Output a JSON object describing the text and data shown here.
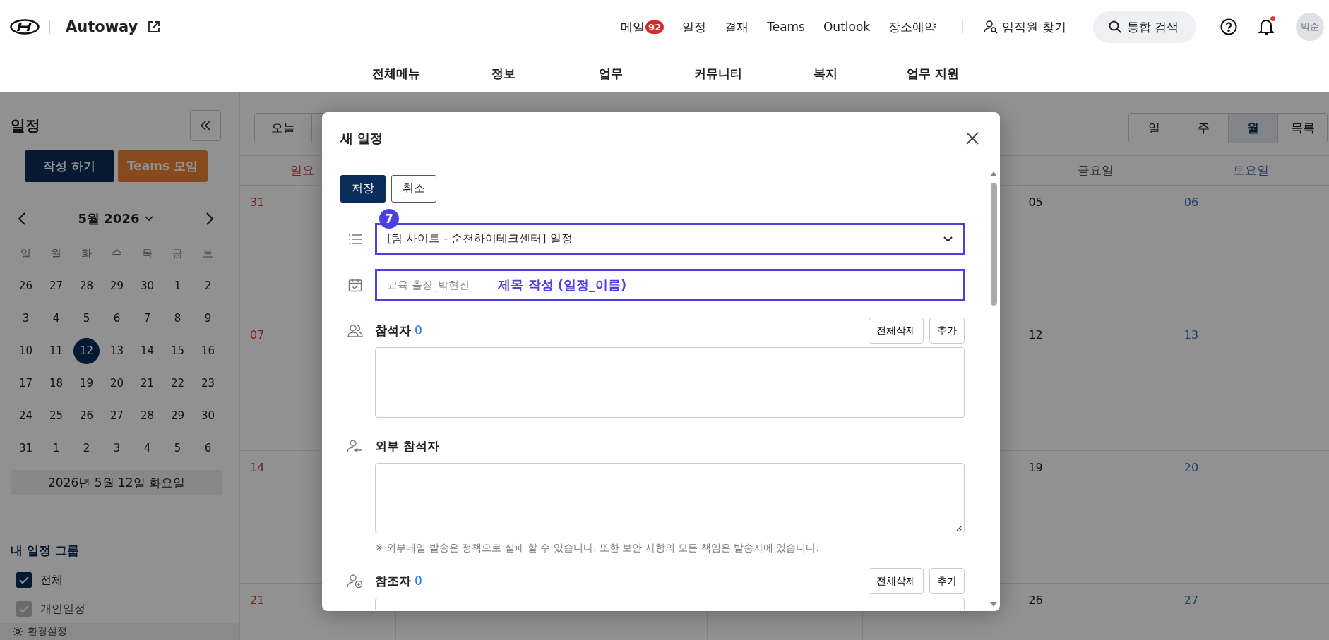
{
  "header": {
    "site_name": "Autoway",
    "nav_links": [
      {
        "label": "메일",
        "badge": "92"
      },
      {
        "label": "일정"
      },
      {
        "label": "결재"
      },
      {
        "label": "Teams"
      },
      {
        "label": "Outlook"
      },
      {
        "label": "장소예약"
      }
    ],
    "people_search": "임직원 찾기",
    "search_button": "통합 검색",
    "notifications": {
      "unread": true
    },
    "avatar": "박순"
  },
  "main_menu": [
    "전체메뉴",
    "정보",
    "업무",
    "커뮤니티",
    "복지",
    "업무 지원"
  ],
  "sidebar": {
    "title": "일정",
    "create_button": "작성 하기",
    "teams_button": "Teams 모임",
    "mini_calendar": {
      "month": "5월 2026",
      "weekdays": [
        "일",
        "월",
        "화",
        "수",
        "목",
        "금",
        "토"
      ],
      "weeks": [
        [
          {
            "label": "26",
            "selected": false
          },
          {
            "label": "27",
            "selected": false
          },
          {
            "label": "28",
            "selected": false
          },
          {
            "label": "29",
            "selected": false
          },
          {
            "label": "30",
            "selected": false
          },
          {
            "label": "1",
            "selected": false
          },
          {
            "label": "2",
            "selected": false
          }
        ],
        [
          {
            "label": "3",
            "selected": false
          },
          {
            "label": "4",
            "selected": false
          },
          {
            "label": "5",
            "selected": false
          },
          {
            "label": "6",
            "selected": false
          },
          {
            "label": "7",
            "selected": false
          },
          {
            "label": "8",
            "selected": false
          },
          {
            "label": "9",
            "selected": false
          }
        ],
        [
          {
            "label": "10",
            "selected": false
          },
          {
            "label": "11",
            "selected": false
          },
          {
            "label": "12",
            "selected": true
          },
          {
            "label": "13",
            "selected": false
          },
          {
            "label": "14",
            "selected": false
          },
          {
            "label": "15",
            "selected": false
          },
          {
            "label": "16",
            "selected": false
          }
        ],
        [
          {
            "label": "17",
            "selected": false
          },
          {
            "label": "18",
            "selected": false
          },
          {
            "label": "19",
            "selected": false
          },
          {
            "label": "20",
            "selected": false
          },
          {
            "label": "21",
            "selected": false
          },
          {
            "label": "22",
            "selected": false
          },
          {
            "label": "23",
            "selected": false
          }
        ],
        [
          {
            "label": "24",
            "selected": false
          },
          {
            "label": "25",
            "selected": false
          },
          {
            "label": "26",
            "selected": false
          },
          {
            "label": "27",
            "selected": false
          },
          {
            "label": "28",
            "selected": false
          },
          {
            "label": "29",
            "selected": false
          },
          {
            "label": "30",
            "selected": false
          }
        ],
        [
          {
            "label": "31",
            "selected": false
          },
          {
            "label": "1",
            "selected": false
          },
          {
            "label": "2",
            "selected": false
          },
          {
            "label": "3",
            "selected": false
          },
          {
            "label": "4",
            "selected": false
          },
          {
            "label": "5",
            "selected": false
          },
          {
            "label": "6",
            "selected": false
          }
        ]
      ]
    },
    "selected_date": "2026년 5월 12일 화요일",
    "group_title": "내 일정 그룹",
    "groups": [
      {
        "label": "전체",
        "checked": true,
        "disabled": false
      },
      {
        "label": "개인일정",
        "checked": true,
        "disabled": true
      }
    ],
    "settings": "환경설정"
  },
  "calendar": {
    "today_button": "오늘",
    "views": [
      {
        "label": "일",
        "selected": false
      },
      {
        "label": "주",
        "selected": false
      },
      {
        "label": "월",
        "selected": true
      },
      {
        "label": "목록",
        "selected": false
      }
    ],
    "columns": [
      {
        "header": "일요",
        "kind": "sunday",
        "dates": [
          "31",
          "07",
          "14",
          "21"
        ]
      },
      {
        "header": "금요일",
        "kind": "weekday",
        "dates": [
          "05",
          "12",
          "19",
          "26"
        ]
      },
      {
        "header": "토요일",
        "kind": "saturday",
        "dates": [
          "06",
          "13",
          "20",
          "27"
        ]
      }
    ]
  },
  "dialog": {
    "title": "새 일정",
    "save_button": "저장",
    "cancel_button": "취소",
    "step_badge": "7",
    "calendar_select": {
      "value": "[팀 사이트 - 순천하이테크센터] 일정",
      "highlighted": true
    },
    "title_field": {
      "placeholder": "교육 출장_박현진",
      "annotation": "제목 작성 (일정_이름)",
      "highlighted": true
    },
    "sections": [
      {
        "kind": "attendees",
        "label": "참석자",
        "count": "0",
        "buttons": [
          "전체삭제",
          "추가"
        ]
      },
      {
        "kind": "external",
        "label": "외부 참석자",
        "note": "※ 외부메일 발송은 정책으로 실패 할 수 있습니다. 또한 보안 사항의 모든 책임은 발송자에 있습니다."
      },
      {
        "kind": "cc",
        "label": "참조자",
        "count": "0",
        "buttons": [
          "전체삭제",
          "추가"
        ]
      }
    ]
  }
}
